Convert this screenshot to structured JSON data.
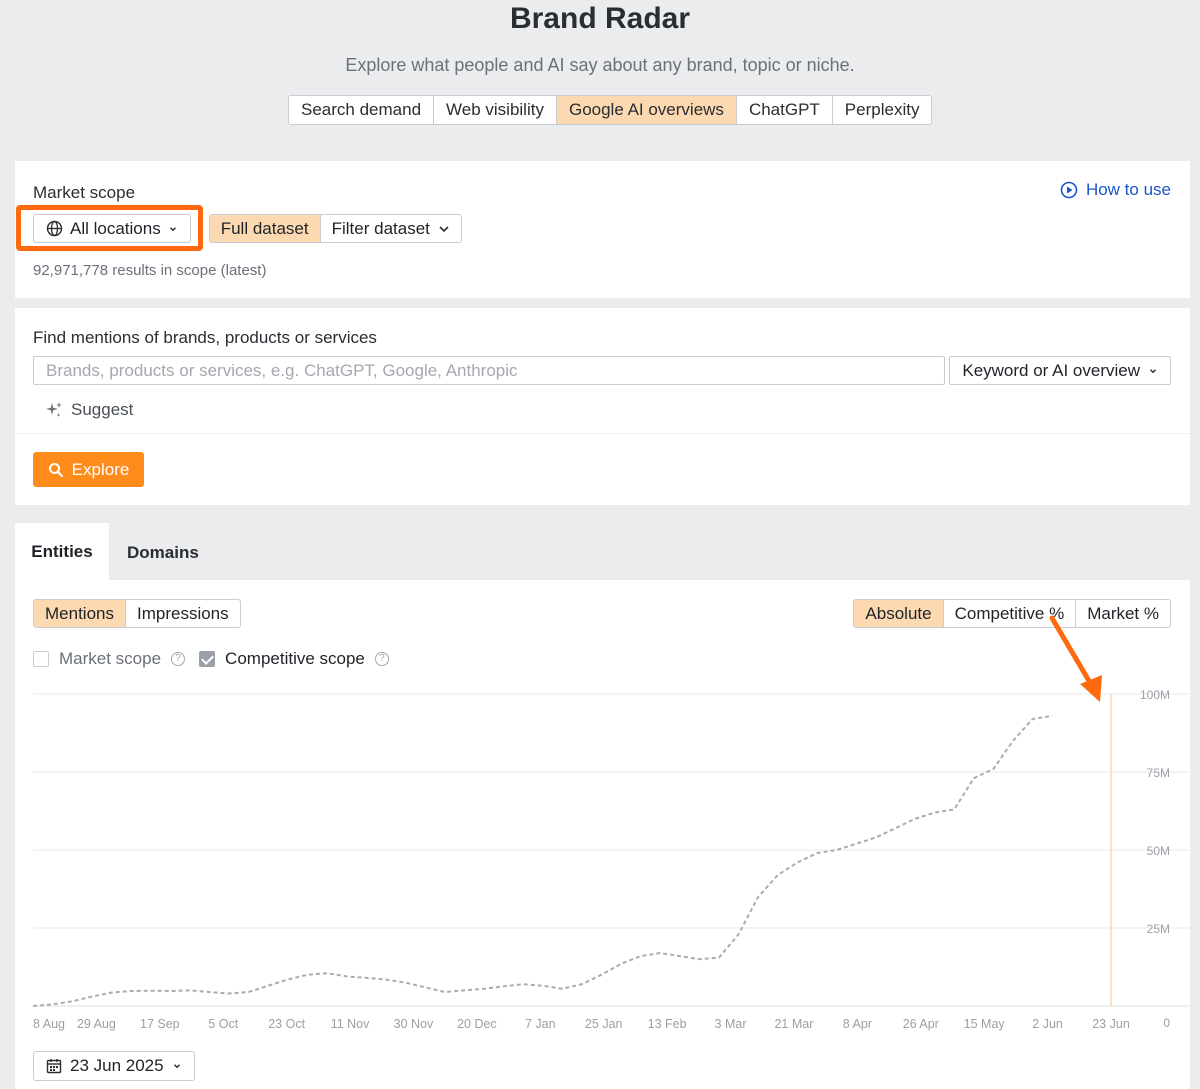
{
  "header": {
    "title": "Brand Radar",
    "subtitle": "Explore what people and AI say about any brand, topic or niche."
  },
  "top_tabs": [
    {
      "label": "Search demand",
      "active": false
    },
    {
      "label": "Web visibility",
      "active": false
    },
    {
      "label": "Google AI overviews",
      "active": true
    },
    {
      "label": "ChatGPT",
      "active": false
    },
    {
      "label": "Perplexity",
      "active": false
    }
  ],
  "scope": {
    "label": "Market scope",
    "how_to_use": "How to use",
    "location": "All locations",
    "full_dataset": "Full dataset",
    "filter_dataset": "Filter dataset",
    "results": "92,971,778 results in scope (latest)"
  },
  "find": {
    "label": "Find mentions of brands, products or services",
    "placeholder": "Brands, products or services, e.g. ChatGPT, Google, Anthropic",
    "mode": "Keyword or AI overview",
    "suggest": "Suggest",
    "explore": "Explore"
  },
  "results_tabs": {
    "entities": "Entities",
    "domains": "Domains"
  },
  "metric_toggle": {
    "mentions": "Mentions",
    "impressions": "Impressions"
  },
  "view_toggle": {
    "absolute": "Absolute",
    "competitive": "Competitive %",
    "market": "Market %"
  },
  "checkboxes": {
    "market_scope": "Market scope",
    "competitive_scope": "Competitive scope"
  },
  "date_picker": "23 Jun 2025",
  "colors": {
    "accent": "#ff8c1a",
    "highlight": "#ff6a0f",
    "active_tab": "#fcd9b0",
    "link": "#1a56c9"
  },
  "chart_data": {
    "type": "line",
    "x_tick_labels": [
      "8 Aug",
      "29 Aug",
      "17 Sep",
      "5 Oct",
      "23 Oct",
      "11 Nov",
      "30 Nov",
      "20 Dec",
      "7 Jan",
      "25 Jan",
      "13 Feb",
      "3 Mar",
      "21 Mar",
      "8 Apr",
      "26 Apr",
      "15 May",
      "2 Jun",
      "23 Jun"
    ],
    "y_tick_labels": [
      "0",
      "25M",
      "50M",
      "75M",
      "100M"
    ],
    "ylim": [
      0,
      100000000
    ],
    "selected_x": "23 Jun",
    "series": [
      {
        "style": "dashed",
        "color": "#a8acb2",
        "points": [
          [
            0,
            0
          ],
          [
            5,
            500000
          ],
          [
            10,
            1500000
          ],
          [
            15,
            3000000
          ],
          [
            20,
            4300000
          ],
          [
            25,
            4800000
          ],
          [
            30,
            4900000
          ],
          [
            35,
            4800000
          ],
          [
            40,
            5000000
          ],
          [
            45,
            4500000
          ],
          [
            50,
            4000000
          ],
          [
            55,
            4500000
          ],
          [
            60,
            6500000
          ],
          [
            65,
            8500000
          ],
          [
            70,
            10000000
          ],
          [
            75,
            10500000
          ],
          [
            80,
            9500000
          ],
          [
            85,
            9000000
          ],
          [
            90,
            8500000
          ],
          [
            95,
            7500000
          ],
          [
            100,
            6000000
          ],
          [
            105,
            4500000
          ],
          [
            110,
            5000000
          ],
          [
            115,
            5500000
          ],
          [
            120,
            6300000
          ],
          [
            125,
            7000000
          ],
          [
            130,
            6500000
          ],
          [
            135,
            5500000
          ],
          [
            140,
            7000000
          ],
          [
            145,
            10000000
          ],
          [
            150,
            13500000
          ],
          [
            155,
            16000000
          ],
          [
            160,
            17000000
          ],
          [
            165,
            16000000
          ],
          [
            170,
            15000000
          ],
          [
            175,
            15500000
          ],
          [
            180,
            23000000
          ],
          [
            185,
            35000000
          ],
          [
            190,
            42000000
          ],
          [
            195,
            46000000
          ],
          [
            200,
            49000000
          ],
          [
            205,
            50000000
          ],
          [
            210,
            52000000
          ],
          [
            215,
            54000000
          ],
          [
            220,
            57000000
          ],
          [
            225,
            60000000
          ],
          [
            230,
            62000000
          ],
          [
            235,
            63000000
          ],
          [
            240,
            73000000
          ],
          [
            245,
            76000000
          ],
          [
            250,
            85000000
          ],
          [
            255,
            92000000
          ],
          [
            260,
            93000000
          ]
        ]
      }
    ]
  }
}
